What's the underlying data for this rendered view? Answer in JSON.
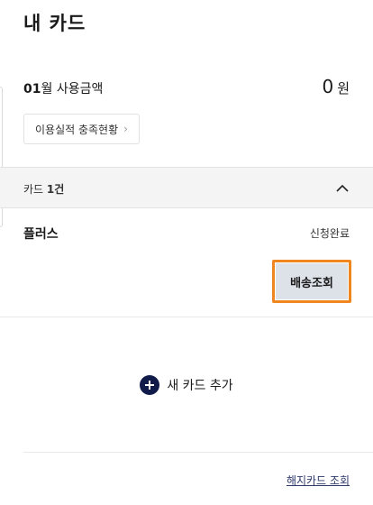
{
  "header": {
    "title": "내 카드"
  },
  "usage": {
    "month_num": "01",
    "month_suffix": "월 사용금액",
    "amount": "0",
    "unit": "원",
    "performance_button": "이용실적 충족현황"
  },
  "cards_section": {
    "label_prefix": "카드 ",
    "count": "1건",
    "card": {
      "name": "플러스",
      "status": "신청완료",
      "track_button": "배송조회"
    }
  },
  "add_card": {
    "label": "새 카드 추가"
  },
  "footer": {
    "terminated_link": "해지카드 조회"
  },
  "colors": {
    "highlight": "#f0861f",
    "plus_bg": "#111b4a",
    "track_bg": "#dde1e8"
  }
}
